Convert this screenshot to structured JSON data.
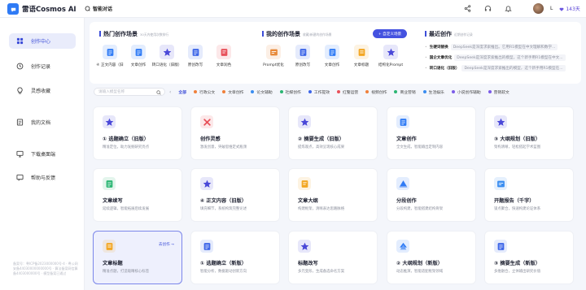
{
  "app": {
    "name": "雷语Cosmos AI",
    "chat_entry": "智能对话"
  },
  "user": {
    "initial": "L",
    "points": "143天"
  },
  "sidebar": {
    "items": [
      {
        "label": "创作中心",
        "icon": "grid-icon",
        "active": true
      },
      {
        "label": "创作记录",
        "icon": "history-icon",
        "active": false
      },
      {
        "label": "灵感收藏",
        "icon": "bulb-icon",
        "active": false
      },
      {
        "label": "我的文档",
        "icon": "folder-icon",
        "active": false
      },
      {
        "label": "下载桌面端",
        "icon": "desktop-icon",
        "active": false
      },
      {
        "label": "帮助与反馈",
        "icon": "help-icon",
        "active": false
      }
    ],
    "footer": "备案号：粤ICP备2023000000号-4 · 粤公网安备44030000000000号 · 算法备案网信算备4403000000号 · 模型备案已通过"
  },
  "panels": {
    "hot": {
      "title": "热门创作场景",
      "subtitle": "30天内使用次数排行",
      "items": [
        {
          "label": "④ 正文内容（旧",
          "color": "#2f7bf5"
        },
        {
          "label": "文章创作",
          "color": "#2f7bf5"
        },
        {
          "label": "转口语化（旧版）",
          "color": "#4a48d8"
        },
        {
          "label": "原创改写",
          "color": "#3d66e8"
        },
        {
          "label": "文章润色",
          "color": "#e8515a"
        }
      ]
    },
    "mine": {
      "title": "我的创作场景",
      "subtitle": "收藏/新建的创作场景",
      "custom_button": "+ 自定义场景",
      "items": [
        {
          "label": "Prompt优化",
          "color": "#e88a3a"
        },
        {
          "label": "原创改写",
          "color": "#3d66e8"
        },
        {
          "label": "文章创作",
          "color": "#2f7bf5"
        },
        {
          "label": "文章标题",
          "color": "#f2a623"
        },
        {
          "label": "结构化Prompt",
          "color": "#4a48d8"
        }
      ]
    },
    "recent": {
      "title": "最近创作",
      "subtitle": "近期创作记录",
      "rows": [
        {
          "name": "生硬词替换",
          "snippet": "DeepSeek是深度求索推出。它用R1模型在中文理解和数学..."
        },
        {
          "name": "国企文章优化",
          "snippet": "DeepSeek是深度求索推出的模型，这个新手用R1模型在中文..."
        },
        {
          "name": "转口语化（旧版）",
          "snippet": "DeepSeek是深度求索推出的模型，这个新手用R1模型在..."
        }
      ]
    }
  },
  "search": {
    "placeholder": "请输入模型名称"
  },
  "categories": [
    {
      "label": "全部",
      "color": "",
      "active": true
    },
    {
      "label": "行政公文",
      "color": "#f0803a"
    },
    {
      "label": "文章创作",
      "color": "#f0803a"
    },
    {
      "label": "论文辅助",
      "color": "#3a8df0"
    },
    {
      "label": "社媒创作",
      "color": "#2bb673"
    },
    {
      "label": "工作提效",
      "color": "#3d66e8"
    },
    {
      "label": "红警运营",
      "color": "#e8515a"
    },
    {
      "label": "视频创作",
      "color": "#f0803a"
    },
    {
      "label": "商业营销",
      "color": "#2bb673"
    },
    {
      "label": "生活娱乐",
      "color": "#3a8df0"
    },
    {
      "label": "小说创作辅助",
      "color": "#7c5ce8"
    },
    {
      "label": "营销软文",
      "color": "#7c5ce8"
    }
  ],
  "cards": [
    {
      "title": "① 选题确立（旧版）",
      "desc": "精准定位，助力发掘研究亮点",
      "icon": "star-icon",
      "color": "#4a48d8"
    },
    {
      "title": "创作灵感",
      "desc": "激发创意，突破思维定式瓶颈",
      "icon": "spark-icon",
      "color": "#e8515a"
    },
    {
      "title": "② 摘要生成（旧版）",
      "desc": "提炼观点，高效呈现核心成果",
      "icon": "star-icon",
      "color": "#4a48d8"
    },
    {
      "title": "文章创作",
      "desc": "全文生成，智能输出定制内容",
      "icon": "doc-icon",
      "color": "#2f7bf5"
    },
    {
      "title": "③ 大纲规划（旧版）",
      "desc": "架构清晰，轻松搭起学术蓝图",
      "icon": "star-icon",
      "color": "#4a48d8"
    },
    {
      "title": "文章续写",
      "desc": "延续逻辑，智能拓展后续发展",
      "icon": "pen-icon",
      "color": "#2bb673"
    },
    {
      "title": "④ 正文内容（旧版）",
      "desc": "填充细节，系统构筑完整论述",
      "icon": "star-icon",
      "color": "#4a48d8"
    },
    {
      "title": "文章大纲",
      "desc": "构建框架，清晰表达思路脉络",
      "icon": "outline-icon",
      "color": "#f2a623"
    },
    {
      "title": "分段创作",
      "desc": "分段构建，智能搭建结构骨架",
      "icon": "layers-icon",
      "color": "#2f7bf5"
    },
    {
      "title": "开题报告（千字）",
      "desc": "锁点聚合，快速构建论证体系",
      "icon": "report-icon",
      "color": "#3a8df0"
    },
    {
      "title": "文章标题",
      "desc": "精准点题，打造吸睛核心标签",
      "icon": "title-icon",
      "color": "#f2a623",
      "selected": true,
      "goto": "去创作 →"
    },
    {
      "title": "① 选题确立（新版）",
      "desc": "智能分析，数据驱动创新方向",
      "icon": "doc-icon",
      "color": "#3d66e8"
    },
    {
      "title": "标题改写",
      "desc": "多元变形，生成备选命名方案",
      "icon": "star-icon",
      "color": "#4a48d8"
    },
    {
      "title": "② 大纲规划（新版）",
      "desc": "动态推演，智能适配框架领域",
      "icon": "tree-icon",
      "color": "#2f7bf5"
    },
    {
      "title": "③ 摘要生成（新版）",
      "desc": "多维融合，立体输出研究价值",
      "icon": "doc-icon",
      "color": "#3d66e8"
    }
  ]
}
